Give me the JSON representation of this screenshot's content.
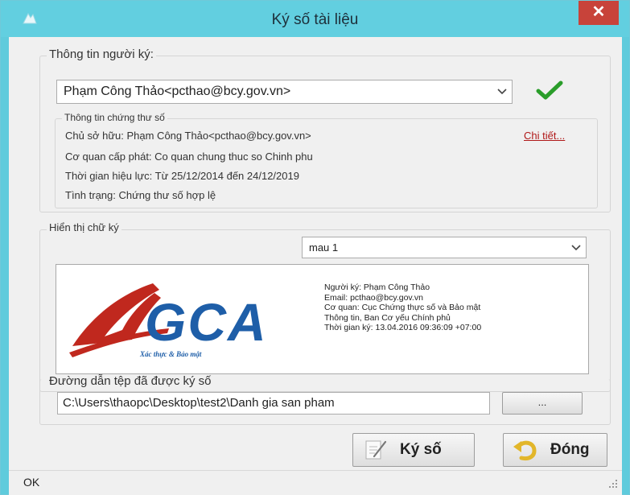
{
  "window": {
    "title": "Ký số tài liệu",
    "close_glyph": "✕"
  },
  "signer_group": {
    "legend": "Thông tin người ký:",
    "selected_signer": "Phạm Công Thảo<pcthao@bcy.gov.vn>",
    "valid_icon": "check-icon",
    "cert": {
      "legend": "Thông tin chứng thư số",
      "owner": "Chủ sở hữu: Phạm Công Thảo<pcthao@bcy.gov.vn>",
      "details_link": "Chi tiết...",
      "issuer": "Cơ quan cấp phát: Co quan chung thuc so Chinh phu",
      "validity": "Thời gian hiệu lực: Từ 25/12/2014 đến 24/12/2019",
      "status": "Tình trạng: Chứng thư số hợp lệ"
    }
  },
  "signature_display": {
    "legend": "Hiển thị chữ ký",
    "template_selected": "mau 1",
    "logo": {
      "text": "GCA",
      "tagline": "Xác thực & Bảo mật"
    },
    "preview_lines": [
      "Người ký: Phạm Công Thảo",
      "Email: pcthao@bcy.gov.vn",
      "Cơ quan: Cục Chứng thực số và Bảo mật",
      "Thông tin, Ban Cơ yếu Chính phủ",
      "Thời gian ký: 13.04.2016 09:36:09 +07:00"
    ]
  },
  "path_group": {
    "legend": "Đường dẫn tệp đã được ký số",
    "value": "C:\\Users\\thaopc\\Desktop\\test2\\Danh gia san pham",
    "browse_label": "..."
  },
  "buttons": {
    "sign": "Ký số",
    "close": "Đóng"
  },
  "status_bar": {
    "text": "OK"
  },
  "colors": {
    "titlebar": "#62cfe0",
    "close_button": "#c8433a",
    "check": "#2a9d2a",
    "link": "#b01818",
    "logo_red": "#c0281e",
    "logo_blue": "#1e5ea8"
  }
}
